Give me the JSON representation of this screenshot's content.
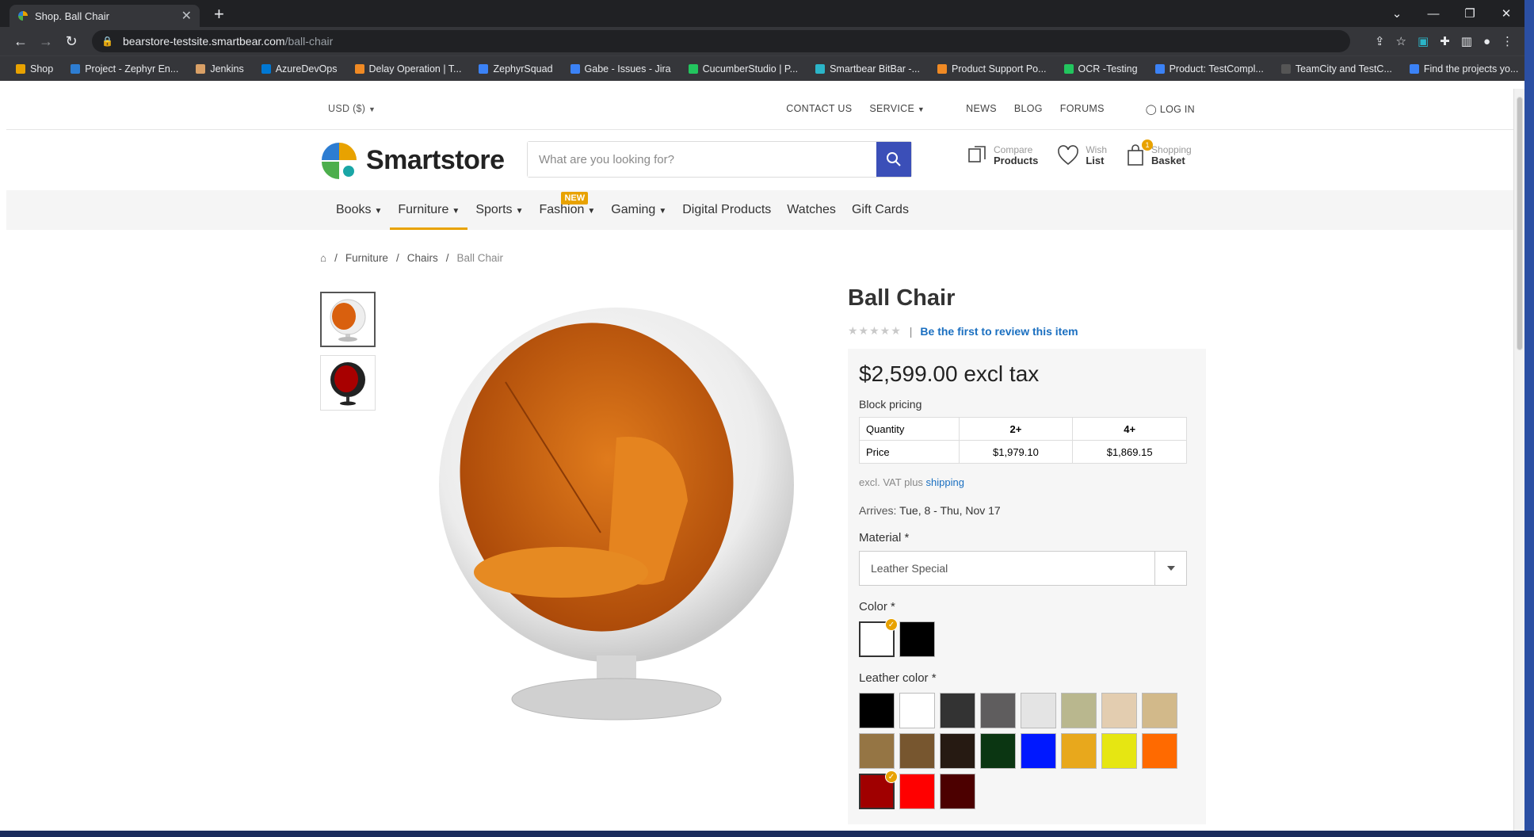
{
  "browser": {
    "tab_title": "Shop. Ball Chair",
    "url_host": "bearstore-testsite.smartbear.com",
    "url_path": "/ball-chair",
    "bookmarks": [
      {
        "label": "Shop",
        "color": "#e8a200"
      },
      {
        "label": "Project - Zephyr En...",
        "color": "#2d7dd2"
      },
      {
        "label": "Jenkins",
        "color": "#d9a066"
      },
      {
        "label": "AzureDevOps",
        "color": "#0078d4"
      },
      {
        "label": "Delay Operation | T...",
        "color": "#f08a24"
      },
      {
        "label": "ZephyrSquad",
        "color": "#3b82f6"
      },
      {
        "label": "Gabe - Issues - Jira",
        "color": "#3b82f6"
      },
      {
        "label": "CucumberStudio | P...",
        "color": "#22c55e"
      },
      {
        "label": "Smartbear BitBar -...",
        "color": "#2bb5c8"
      },
      {
        "label": "Product Support Po...",
        "color": "#f08a24"
      },
      {
        "label": "OCR -Testing",
        "color": "#22c55e"
      },
      {
        "label": "Product: TestCompl...",
        "color": "#3b82f6"
      },
      {
        "label": "TeamCity and TestC...",
        "color": "#555555"
      },
      {
        "label": "Find the projects yo...",
        "color": "#3b82f6"
      }
    ]
  },
  "topbar": {
    "currency": "USD  ($)",
    "contact": "CONTACT US",
    "service": "SERVICE",
    "news": "NEWS",
    "blog": "BLOG",
    "forums": "FORUMS",
    "login": "LOG IN"
  },
  "header": {
    "logo_text": "Smartstore",
    "search_placeholder": "What are you looking for?",
    "compare_top": "Compare",
    "compare_bottom": "Products",
    "wish_top": "Wish",
    "wish_bottom": "List",
    "basket_top": "Shopping",
    "basket_bottom": "Basket",
    "basket_count": "1"
  },
  "nav": {
    "items": [
      "Books",
      "Furniture",
      "Sports",
      "Fashion",
      "Gaming",
      "Digital Products",
      "Watches",
      "Gift Cards"
    ],
    "new_badge": "NEW"
  },
  "breadcrumb": {
    "items": [
      "Furniture",
      "Chairs"
    ],
    "current": "Ball Chair"
  },
  "product": {
    "title": "Ball Chair",
    "review_link": "Be the first to review this item",
    "price": "$2,599.00 excl tax",
    "block_pricing_label": "Block pricing",
    "tiers": {
      "row1": [
        "Quantity",
        "2+",
        "4+"
      ],
      "row2": [
        "Price",
        "$1,979.10",
        "$1,869.15"
      ]
    },
    "vat_text": "excl. VAT plus ",
    "shipping_link": "shipping",
    "arrives_label": "Arrives: ",
    "arrives_value": "Tue, 8 - Thu, Nov 17",
    "material_label": "Material *",
    "material_value": "Leather Special",
    "color_label": "Color *",
    "colors": [
      "#ffffff",
      "#000000"
    ],
    "leather_label": "Leather color *",
    "leather_colors": [
      "#000000",
      "#ffffff",
      "#333333",
      "#5f5d5e",
      "#e4e4e4",
      "#b9b78e",
      "#e3cdb0",
      "#d2b98a",
      "#957544",
      "#77562f",
      "#261a12",
      "#0b3612",
      "#0018ff",
      "#e8a81c",
      "#e6e612",
      "#ff6a00",
      "#a00000",
      "#ff0000",
      "#4c0000"
    ]
  }
}
